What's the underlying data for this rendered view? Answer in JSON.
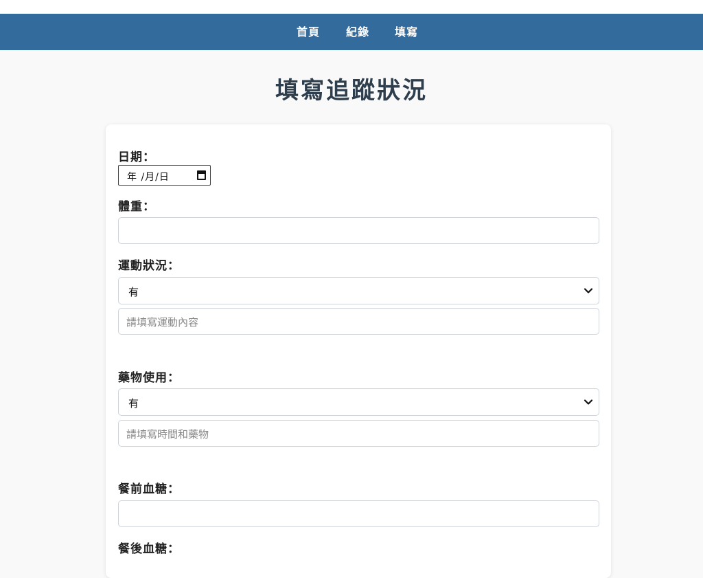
{
  "nav": {
    "items": [
      {
        "label": "首頁"
      },
      {
        "label": "紀錄"
      },
      {
        "label": "填寫"
      }
    ]
  },
  "page": {
    "title": "填寫追蹤狀況"
  },
  "form": {
    "date": {
      "label": "日期：",
      "value": "年 /月/日"
    },
    "weight": {
      "label": "體重：",
      "value": ""
    },
    "exercise": {
      "label": "運動狀況：",
      "selected": "有",
      "detail_placeholder": "請填寫運動內容"
    },
    "medication": {
      "label": "藥物使用：",
      "selected": "有",
      "detail_placeholder": "請填寫時間和藥物"
    },
    "pre_meal_glucose": {
      "label": "餐前血糖：",
      "value": ""
    },
    "post_meal_glucose": {
      "label": "餐後血糖："
    }
  },
  "colors": {
    "navbar": "#336b9c",
    "title": "#2f3e4d"
  }
}
